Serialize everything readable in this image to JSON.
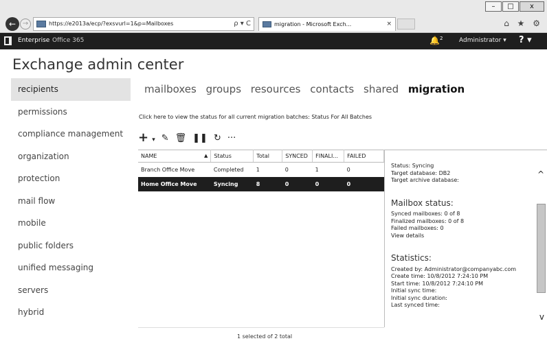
{
  "browser": {
    "url": "https://e2013a/ecp/?exsvurl=1&p=Mailboxes",
    "address_controls": "ρ ▾ C",
    "tab_title": "migration - Microsoft Exch...",
    "tab_close": "×",
    "window_minimize": "–",
    "window_maximize": "□",
    "window_close": "x",
    "icons": "⌂ ★ ⚙"
  },
  "topbar": {
    "enterprise": "Enterprise",
    "office365": "Office 365",
    "notification_icon": "bell-icon",
    "notification_count": "2",
    "user": "Administrator ▾",
    "help": "? ▾"
  },
  "app": {
    "title": "Exchange admin center"
  },
  "sidebar": {
    "items": [
      {
        "label": "recipients",
        "active": true
      },
      {
        "label": "permissions"
      },
      {
        "label": "compliance management"
      },
      {
        "label": "organization"
      },
      {
        "label": "protection"
      },
      {
        "label": "mail flow"
      },
      {
        "label": "mobile"
      },
      {
        "label": "public folders"
      },
      {
        "label": "unified messaging"
      },
      {
        "label": "servers"
      },
      {
        "label": "hybrid"
      }
    ]
  },
  "tabs": [
    {
      "label": "mailboxes"
    },
    {
      "label": "groups"
    },
    {
      "label": "resources"
    },
    {
      "label": "contacts"
    },
    {
      "label": "shared"
    },
    {
      "label": "migration",
      "active": true
    }
  ],
  "status_link": "Click here to view the status for all current migration batches: Status For All Batches",
  "toolbar": {
    "add": "+",
    "add_dropdown": "▾",
    "edit": "✎",
    "delete": "🗑",
    "pause": "❚❚",
    "refresh": "↻",
    "more": "···"
  },
  "grid": {
    "columns": [
      "NAME",
      "Status",
      "Total",
      "SYNCED",
      "FINALI...",
      "FAILED"
    ],
    "sort_indicator": "▲",
    "rows": [
      {
        "name": "Branch Office Move",
        "status": "Completed",
        "total": "1",
        "synced": "0",
        "finalized": "1",
        "failed": "0",
        "selected": false
      },
      {
        "name": "Home Office Move",
        "status": "Syncing",
        "total": "8",
        "synced": "0",
        "finalized": "0",
        "failed": "0",
        "selected": true
      }
    ],
    "footer": "1 selected of 2 total"
  },
  "details": {
    "status": "Status: Syncing",
    "target_db": "Target database: DB2",
    "target_archive": "Target archive database:",
    "mailbox_heading": "Mailbox status:",
    "synced": "Synced mailboxes: 0 of 8",
    "finalized": "Finalized mailboxes: 0 of 8",
    "failed": "Failed mailboxes: 0",
    "view_details": "View details",
    "stats_heading": "Statistics:",
    "created_by": "Created by: Administrator@companyabc.com",
    "create_time": "Create time: 10/8/2012 7:24:10 PM",
    "start_time": "Start time: 10/8/2012 7:24:10 PM",
    "initial_sync_time": "Initial sync time:",
    "initial_sync_duration": "Initial sync duration:",
    "last_synced": "Last synced time:",
    "scroll_up": "^",
    "scroll_down": "v"
  }
}
